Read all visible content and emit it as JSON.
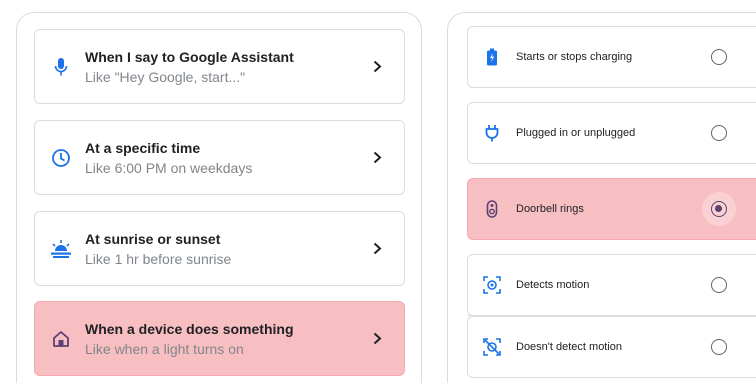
{
  "colors": {
    "accent_blue": "#1a73e8",
    "house_purple": "#5c3f73",
    "highlight_pink": "#f8bfc3",
    "subtitle_gray": "#80868b"
  },
  "starters": [
    {
      "title": "When I say to Google Assistant",
      "subtitle": "Like \"Hey Google, start...\"",
      "icon": "mic-icon",
      "active": false
    },
    {
      "title": "At a specific time",
      "subtitle": "Like 6:00 PM on weekdays",
      "icon": "clock-icon",
      "active": false
    },
    {
      "title": "At sunrise or sunset",
      "subtitle": "Like 1 hr before sunrise",
      "icon": "sunrise-icon",
      "active": false
    },
    {
      "title": "When a device does something",
      "subtitle": "Like when a light turns on",
      "icon": "house-icon",
      "active": true
    }
  ],
  "device_events": [
    {
      "label": "Starts or stops charging",
      "icon": "battery-charging-icon",
      "selected": false
    },
    {
      "label": "Plugged in or unplugged",
      "icon": "plug-icon",
      "selected": false
    },
    {
      "label": "Doorbell rings",
      "icon": "doorbell-icon",
      "selected": true
    },
    {
      "label": "Detects motion",
      "icon": "motion-sensor-icon",
      "selected": false
    },
    {
      "label": "Doesn't detect motion",
      "icon": "no-motion-icon",
      "selected": false
    }
  ]
}
